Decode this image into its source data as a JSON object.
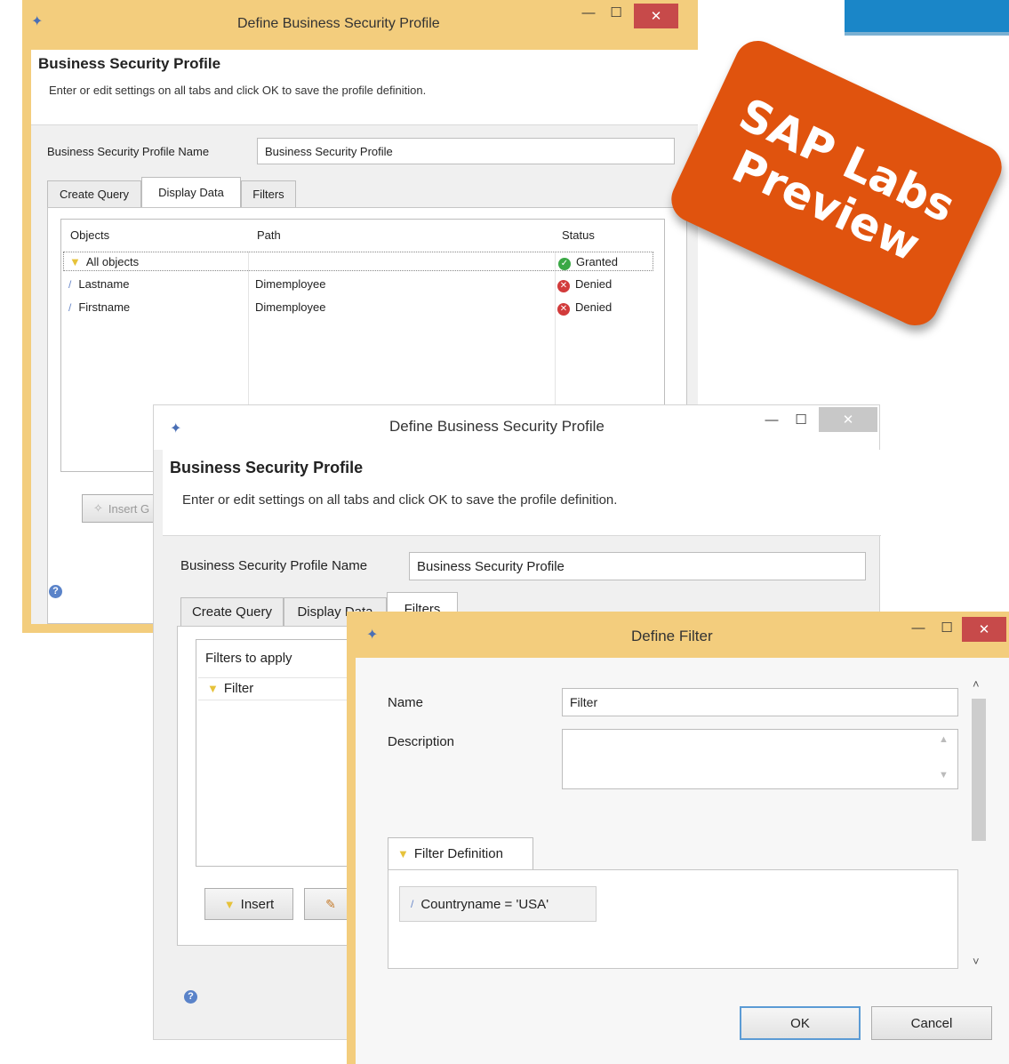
{
  "badge": {
    "line1": "SAP Labs",
    "line2": "Preview"
  },
  "window1": {
    "title": "Define Business Security Profile",
    "header_title": "Business Security Profile",
    "header_desc": "Enter or edit settings on all tabs and click OK to save the profile definition.",
    "name_label": "Business Security Profile Name",
    "name_value": "Business Security Profile",
    "tabs": [
      "Create Query",
      "Display Data",
      "Filters"
    ],
    "columns": [
      "Objects",
      "Path",
      "Status"
    ],
    "rows": [
      {
        "object": "All objects",
        "path": "",
        "status": "Granted"
      },
      {
        "object": "Lastname",
        "path": "Dimemployee",
        "status": "Denied"
      },
      {
        "object": "Firstname",
        "path": "Dimemployee",
        "status": "Denied"
      }
    ],
    "insert_button": "Insert G"
  },
  "window2": {
    "title": "Define Business Security Profile",
    "header_title": "Business Security Profile",
    "header_desc": "Enter or edit settings on all tabs and click OK to save the profile definition.",
    "name_label": "Business Security Profile Name",
    "name_value": "Business Security Profile",
    "tabs": [
      "Create Query",
      "Display Data",
      "Filters"
    ],
    "filters_header": "Filters to apply",
    "filter_item": "Filter",
    "insert_button": "Insert"
  },
  "window3": {
    "title": "Define Filter",
    "name_label": "Name",
    "name_value": "Filter",
    "description_label": "Description",
    "description_value": "",
    "definition_tab": "Filter Definition",
    "definition_expr": "Countryname = 'USA'",
    "ok_button": "OK",
    "cancel_button": "Cancel"
  },
  "colors": {
    "badge": "#e0530e",
    "titlebar_active": "#f3cd7d",
    "close_red": "#c74a4a",
    "granted": "#3aa845",
    "denied": "#d23b3b"
  }
}
